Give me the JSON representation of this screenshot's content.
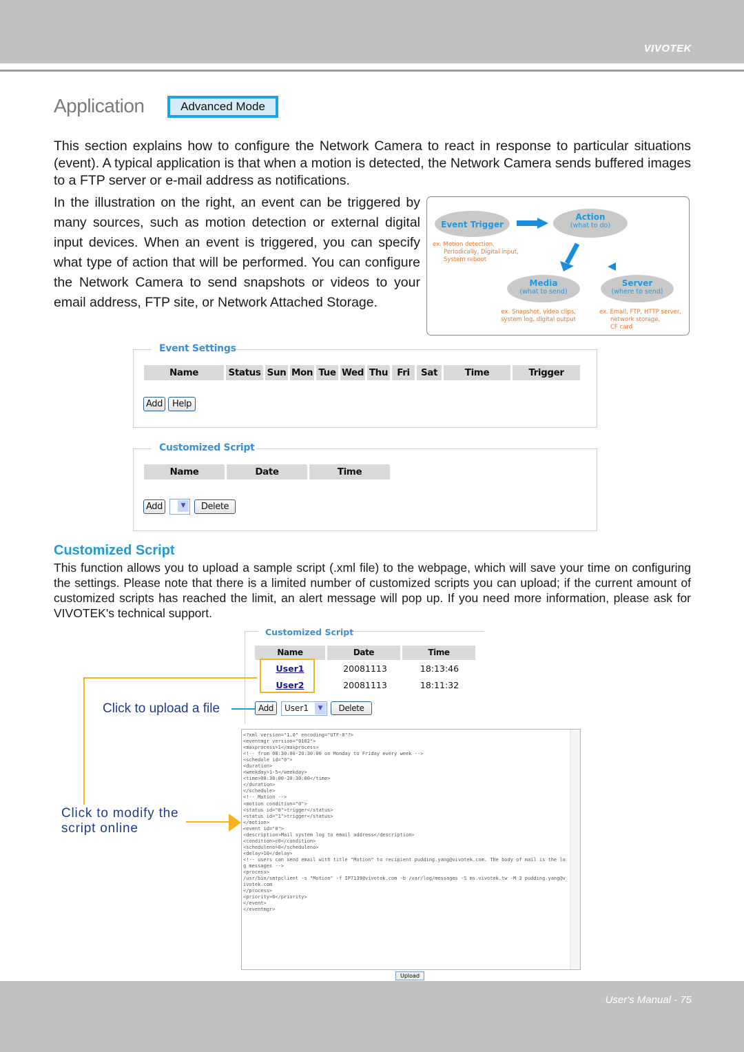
{
  "header": {
    "brand": "VIVOTEK"
  },
  "title": {
    "text": "Application",
    "badge": "Advanced Mode"
  },
  "intro": {
    "paragraph1": "This section explains how to configure the Network Camera to react in response to particular situations (event). A typical application is that when a motion is detected, the Network Camera sends buffered images to a FTP server or e-mail address as notifications.",
    "paragraph2": "In the illustration on the right, an event can be triggered by many sources, such as motion detection or external digital input devices. When an event is triggered, you can specify what type of action that will be performed. You can configure the Network Camera to send snapshots or videos to your email address, FTP site, or Network Attached Storage."
  },
  "diagram": {
    "event_trigger": {
      "title": "Event Trigger",
      "examples": [
        "ex. Motion detection,",
        "Periodically, Digital input,",
        "System reboot"
      ]
    },
    "action": {
      "title": "Action",
      "subtitle": "(what to do)"
    },
    "media": {
      "title": "Media",
      "subtitle": "(what to send)",
      "examples": [
        "ex. Snapshot, video clips,",
        "system log, digital output"
      ]
    },
    "server": {
      "title": "Server",
      "subtitle": "(where to send)",
      "examples": [
        "ex. Email, FTP, HTTP server,",
        "network storage,",
        "CF card"
      ]
    }
  },
  "event_settings": {
    "legend": "Event Settings",
    "columns": [
      "Name",
      "Status",
      "Sun",
      "Mon",
      "Tue",
      "Wed",
      "Thu",
      "Fri",
      "Sat",
      "Time",
      "Trigger"
    ],
    "buttons": {
      "add": "Add",
      "help": "Help"
    }
  },
  "customized_script_panel": {
    "legend": "Customized Script",
    "columns": [
      "Name",
      "Date",
      "Time"
    ],
    "buttons": {
      "add": "Add",
      "delete": "Delete"
    },
    "select_value": ""
  },
  "customized_script_section": {
    "heading": "Customized Script",
    "paragraph": "This function allows you to upload a sample script (.xml file) to the webpage, which will save your time on configuring the settings. Please note that there is a limited number of customized scripts you can upload; if the current amount of customized scripts has reached the limit, an alert message will pop up. If you need more information, please ask for VIVOTEK's technical support."
  },
  "screenshot": {
    "legend": "Customized Script",
    "columns": [
      "Name",
      "Date",
      "Time"
    ],
    "rows": [
      {
        "name": "User1",
        "date": "20081113",
        "time": "18:13:46"
      },
      {
        "name": "User2",
        "date": "20081113",
        "time": "18:11:32"
      }
    ],
    "buttons": {
      "add": "Add",
      "delete": "Delete",
      "upload": "Upload"
    },
    "select_value": "User1",
    "code": "<?xml version=\"1.0\" encoding=\"UTF-8\"?>\n<eventmgr version=\"0102\">\n<maxprocess>1</maxprocess>\n<!-- from 08:30:00-20:30:00 on Monday to Friday every week -->\n<schedule id=\"0\">\n<duration>\n<weekday>1-5</weekday>\n<time>08:30:00-20:30:00</time>\n</duration>\n</schedule>\n<!-- Motion -->\n<motion condition=\"0\">\n<status id=\"0\">trigger</status>\n<status id=\"1\">trigger</status>\n</motion>\n<event id=\"0\">\n<description>Mail system log to email address</description>\n<condition>c0</condition>\n<scheduleno>0</scheduleno>\n<delay>10</delay>\n<!-- users can send email with title \"Motion\" to recipient pudding.yang@vivotek.com. The body of mail is the log messages -->\n<process>\n/usr/bin/smtpclient -s \"Motion\" -f IP7139@vivotek.com -b /var/log/messages -S ms.vivotek.tw -M 3 pudding.yang@vivotek.com\n</process>\n<priority>0</priority>\n</event>\n</eventmgr>"
  },
  "callouts": {
    "upload": "Click to upload a file",
    "modify": "Click to modify the script online"
  },
  "footer": {
    "page_label": "User's Manual - 75"
  },
  "colors": {
    "accent_blue": "#1e9ad8",
    "callout_orange": "#f7b21c",
    "band_gray": "#c0c1c0"
  }
}
